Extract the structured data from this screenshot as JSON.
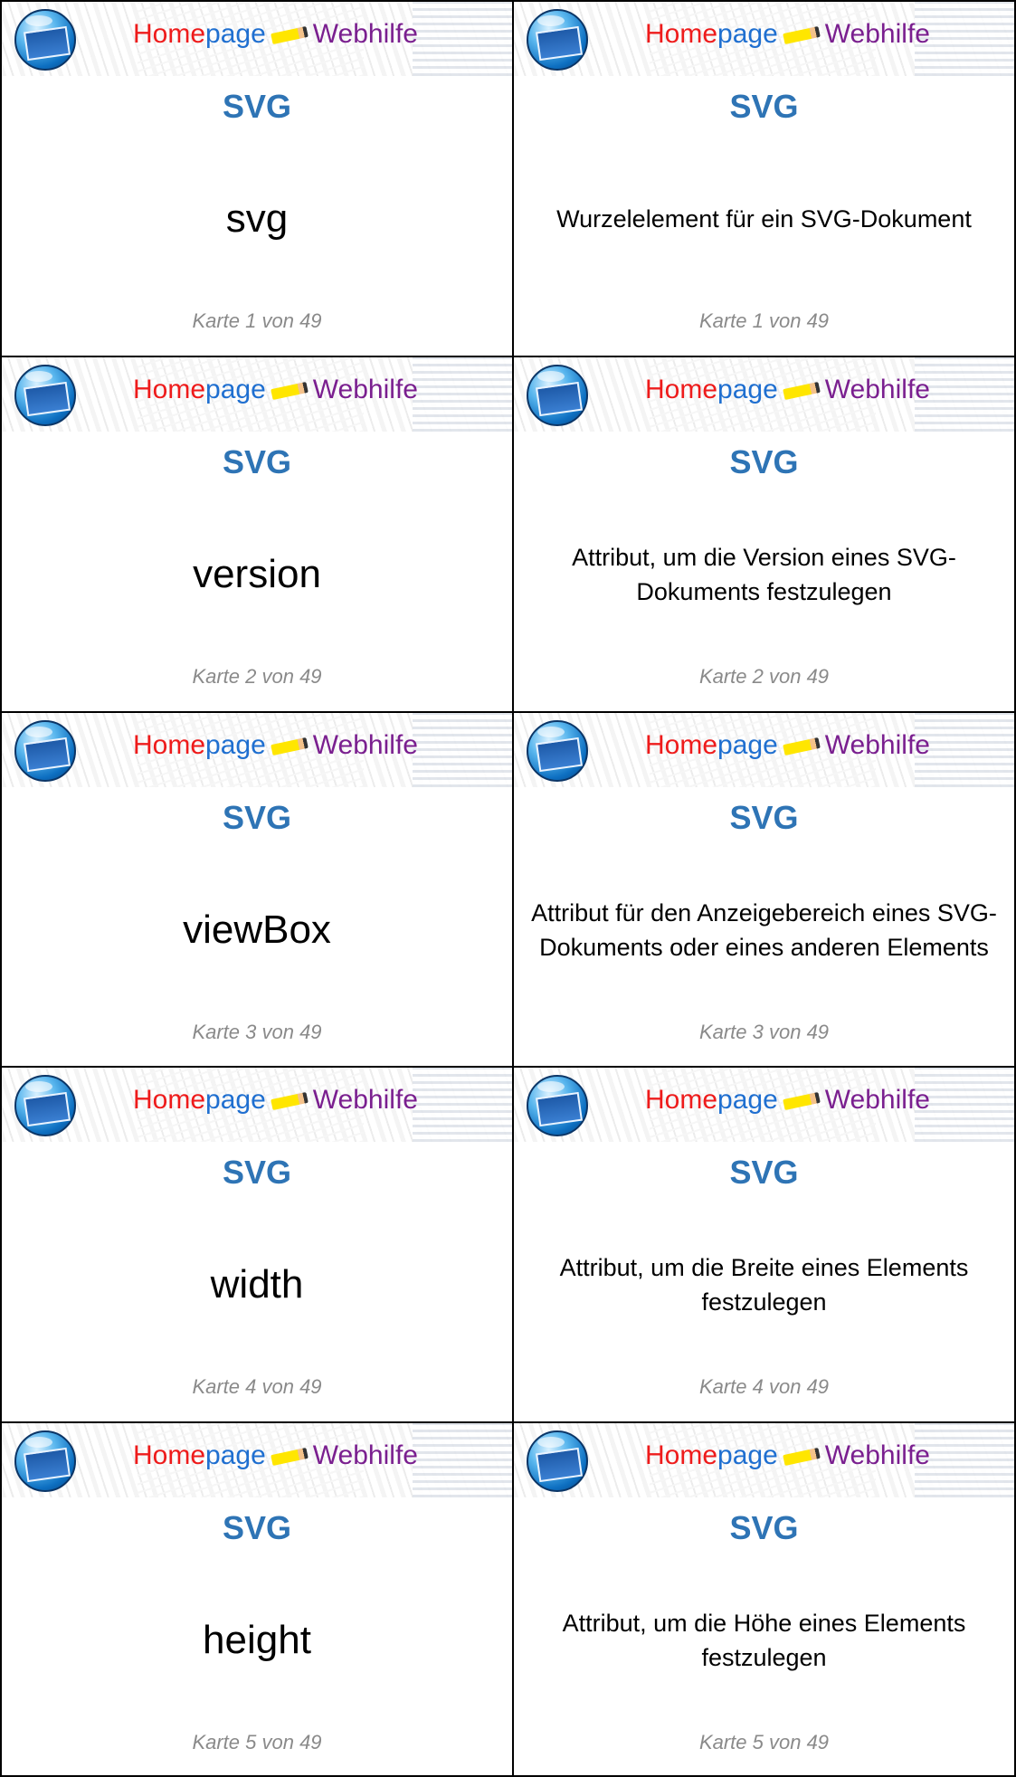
{
  "banner": {
    "brand_home": "Home",
    "brand_page": "page",
    "brand_web": "Webhilfe"
  },
  "colors": {
    "title": "#2e74b5",
    "brand_red": "#ee1b1b",
    "brand_blue": "#1f6fd0",
    "brand_purple": "#7a1f8f",
    "footer": "#8a8a8a"
  },
  "cards": [
    {
      "title": "SVG",
      "term": "svg",
      "definition": "Wurzelelement für ein SVG-Dokument",
      "footer": "Karte 1 von 49"
    },
    {
      "title": "SVG",
      "term": "version",
      "definition": "Attribut, um die Version eines SVG-Dokuments festzulegen",
      "footer": "Karte 2 von 49"
    },
    {
      "title": "SVG",
      "term": "viewBox",
      "definition": "Attribut für den Anzeigebereich eines SVG-Dokuments oder eines anderen Elements",
      "footer": "Karte 3 von 49"
    },
    {
      "title": "SVG",
      "term": "width",
      "definition": "Attribut, um die Breite eines Elements festzulegen",
      "footer": "Karte 4 von 49"
    },
    {
      "title": "SVG",
      "term": "height",
      "definition": "Attribut, um die Höhe eines Elements festzulegen",
      "footer": "Karte 5 von 49"
    }
  ]
}
